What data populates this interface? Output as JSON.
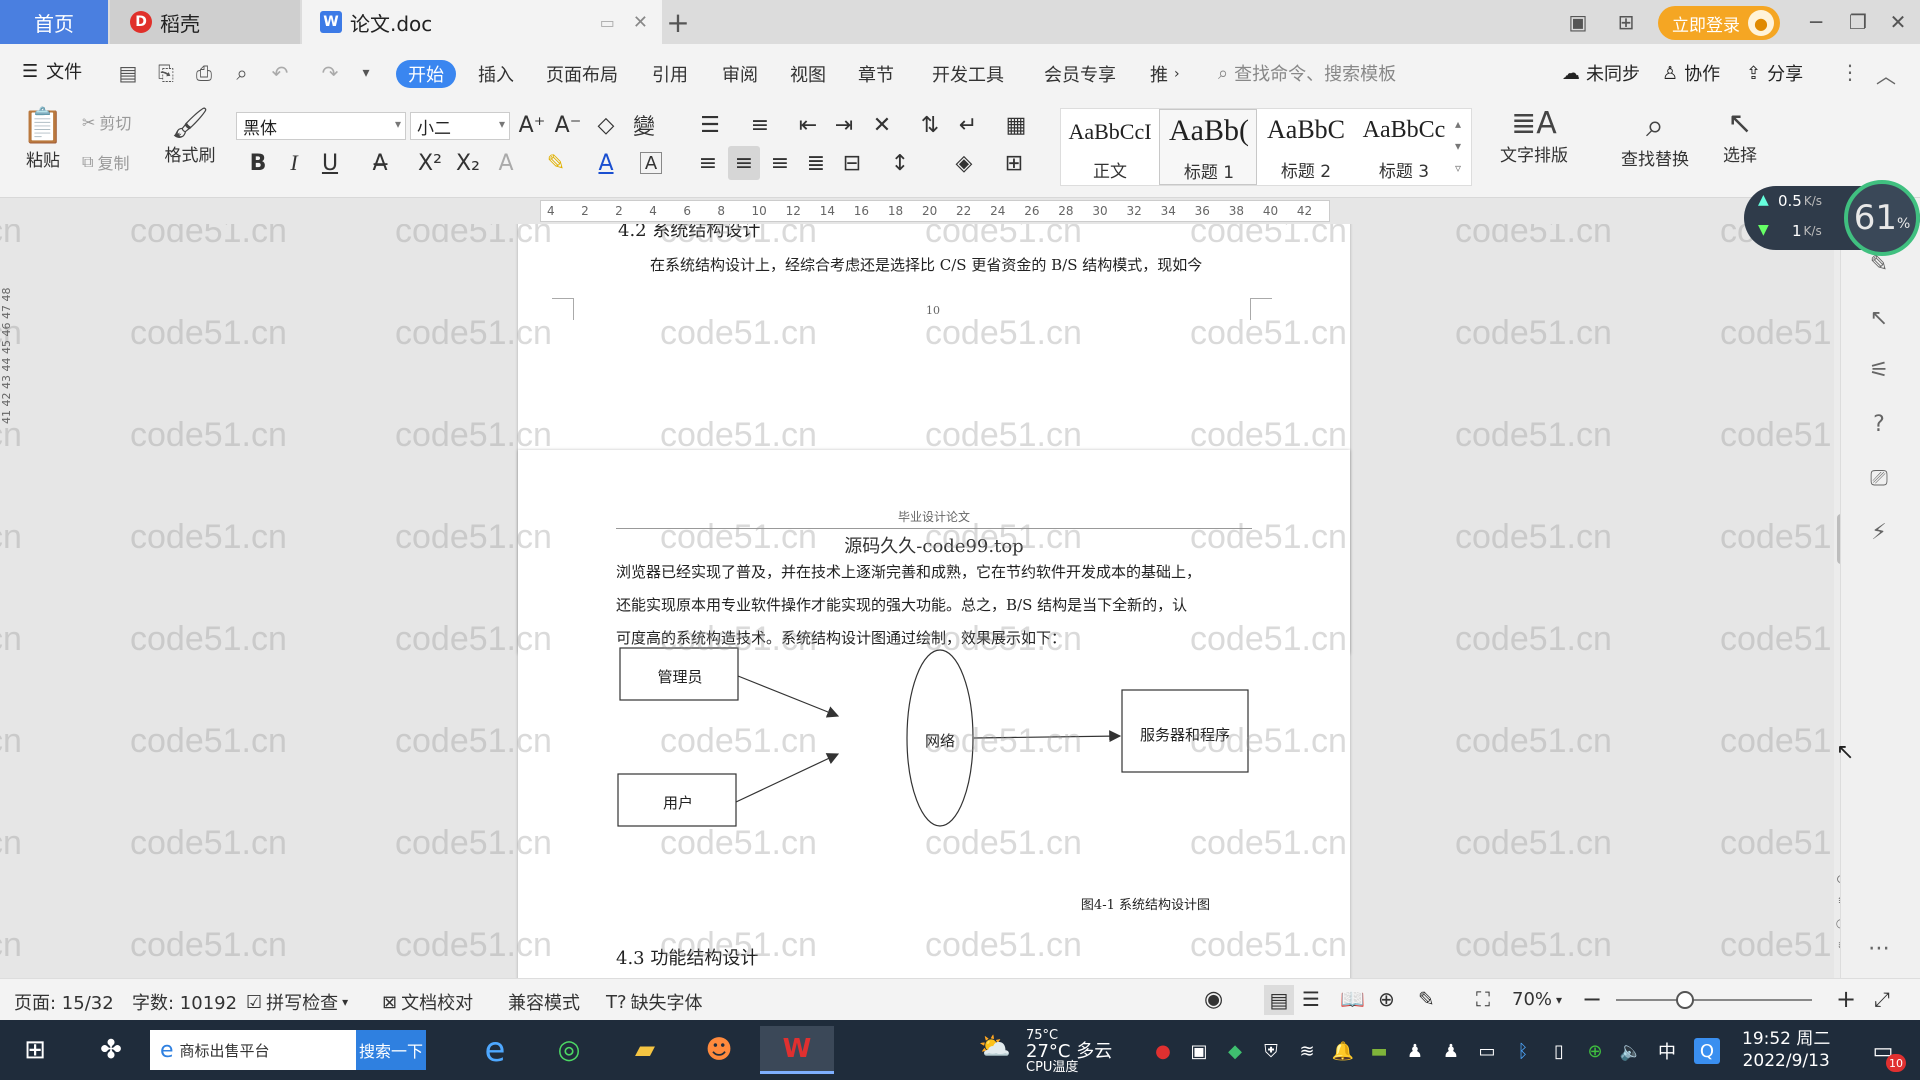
{
  "titlebar": {
    "tabs": [
      {
        "label": "首页"
      },
      {
        "label": "稻壳"
      },
      {
        "label": "论文.doc"
      }
    ],
    "login_label": "立即登录",
    "icons": [
      "layout-icon",
      "grid-icon",
      "minimize-icon",
      "restore-icon",
      "close-icon"
    ]
  },
  "menubar": {
    "file_label": "文件",
    "items": [
      "开始",
      "插入",
      "页面布局",
      "引用",
      "审阅",
      "视图",
      "章节",
      "开发工具",
      "会员专享",
      "推"
    ],
    "active": "开始",
    "search_cmd": "查找命令、搜索模板",
    "sync_label": "未同步",
    "collab_label": "协作",
    "share_label": "分享"
  },
  "ribbon": {
    "paste_label": "粘贴",
    "cut_label": "剪切",
    "copy_label": "复制",
    "format_painter_label": "格式刷",
    "font_name": "黑体",
    "font_size": "小二",
    "styles": [
      {
        "sample": "AaBbCcI",
        "name": "正文"
      },
      {
        "sample": "AaBb(",
        "name": "标题 1"
      },
      {
        "sample": "AaBbC",
        "name": "标题 2"
      },
      {
        "sample": "AaBbCc",
        "name": "标题 3"
      }
    ],
    "text_layout_label": "文字排版",
    "find_replace_label": "查找替换",
    "select_label": "选择"
  },
  "ruler": {
    "ticks": [
      "4",
      "2",
      "2",
      "4",
      "6",
      "8",
      "10",
      "12",
      "14",
      "16",
      "18",
      "20",
      "22",
      "24",
      "26",
      "28",
      "30",
      "32",
      "34",
      "36",
      "38",
      "40",
      "42"
    ]
  },
  "vruler": {
    "text": "41 42 43 44 45 46 47 48"
  },
  "speed": {
    "up": "0.5",
    "down": "1",
    "unit": "K/s",
    "percent": "61",
    "percent_sign": "%"
  },
  "document": {
    "page1_heading": "4.2 系统结构设计",
    "page1_para": "在系统结构设计上，经综合考虑还是选择比 C/S 更省资金的 B/S 结构模式，现如今",
    "page1_number": "10",
    "page2_header": "毕业设计论文",
    "page2_overlay": "源码久久-code99.top",
    "page2_para_lines": [
      "浏览器已经实现了普及，并在技术上逐渐完善和成熟，它在节约软件开发成本的基础上，",
      "还能实现原本用专业软件操作才能实现的强大功能。总之，B/S 结构是当下全新的，认",
      "可度高的系统构造技术。系统结构设计图通过绘制，效果展示如下："
    ],
    "diagram": {
      "admin": "管理员",
      "user": "用户",
      "network": "网络",
      "server": "服务器和程序"
    },
    "figure_caption": "图4-1  系统结构设计图",
    "next_heading": "4.3 功能结构设计"
  },
  "watermark": "code51.cn",
  "statusbar": {
    "page": "页面: 15/32",
    "words": "字数: 10192",
    "spellcheck": "拼写检查",
    "doc_proof": "文档校对",
    "compat_mode": "兼容模式",
    "missing_font": "缺失字体",
    "zoom": "70%",
    "zoom_fraction": 0.35
  },
  "taskbar": {
    "search_text": "商标出售平台",
    "search_btn": "搜索一下",
    "temp": "75°C",
    "weather": "27°C 多云",
    "cpu": "CPU温度",
    "ime": "中",
    "time": "19:52 周二",
    "date": "2022/9/13",
    "notif_count": "10"
  }
}
